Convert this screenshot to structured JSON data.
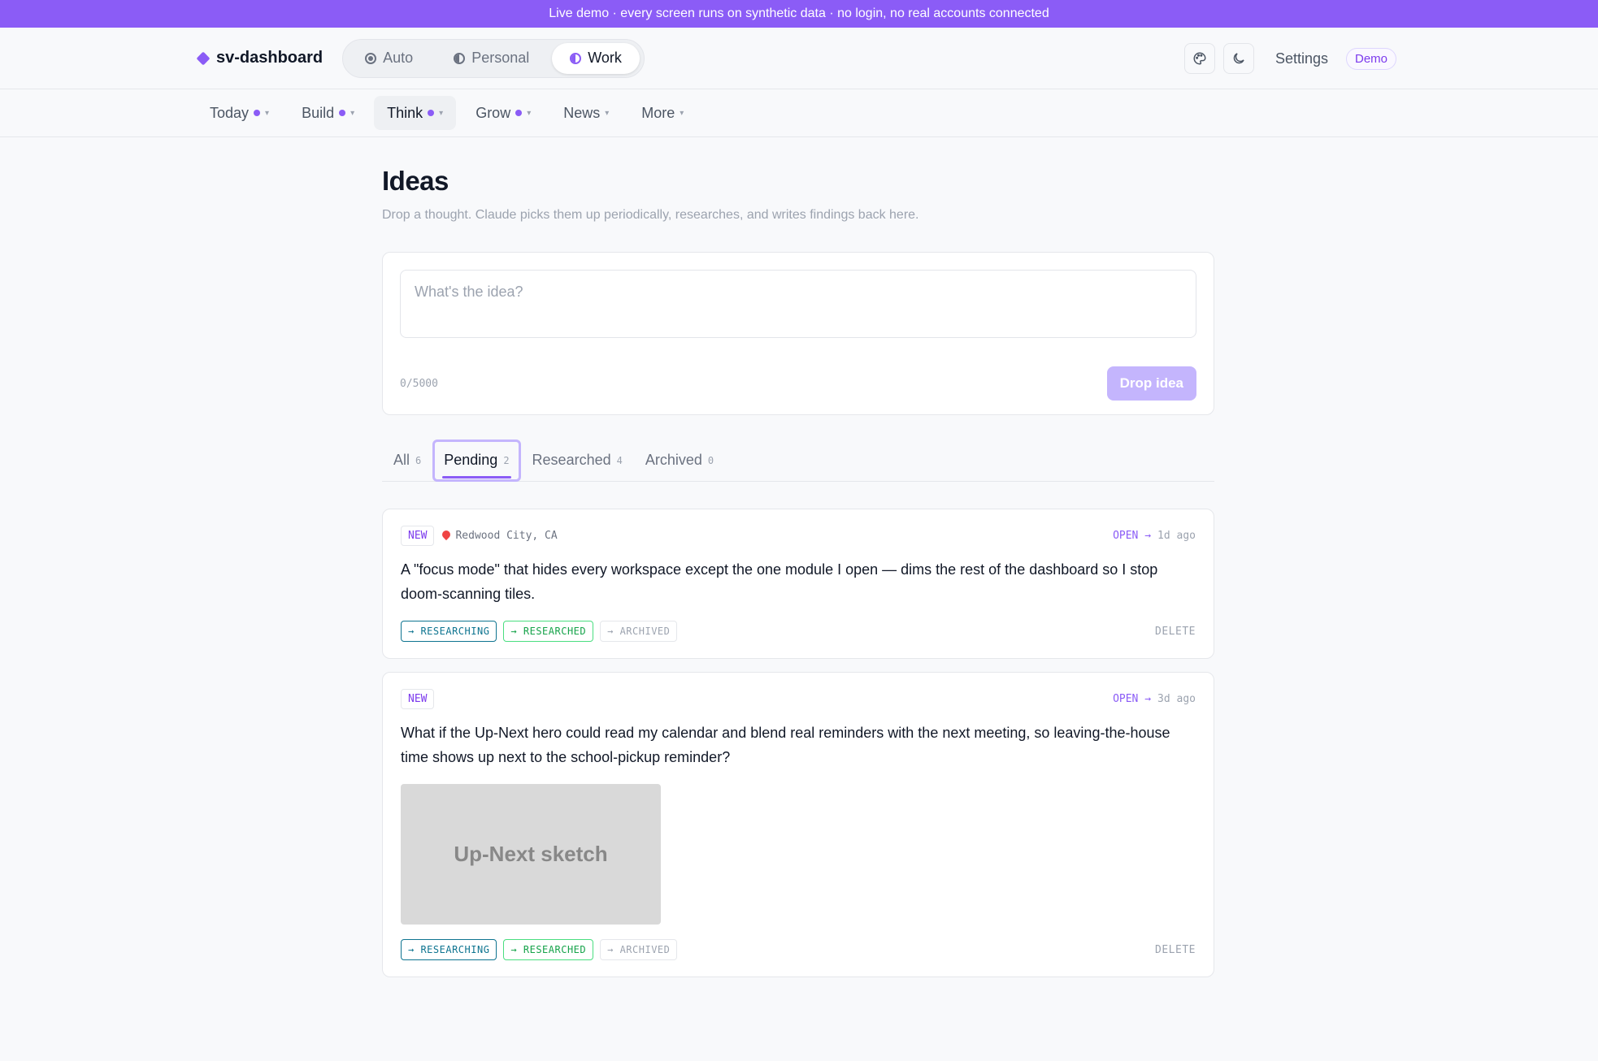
{
  "banner": {
    "text": "Live demo · every screen runs on synthetic data · no login, no real accounts connected"
  },
  "header": {
    "brand": "sv-dashboard",
    "modes": [
      {
        "label": "Auto",
        "icon": "auto-mode-icon",
        "active": false
      },
      {
        "label": "Personal",
        "icon": "personal-mode-icon",
        "active": false
      },
      {
        "label": "Work",
        "icon": "work-mode-icon",
        "active": true
      }
    ],
    "settings_label": "Settings",
    "demo_badge": "Demo"
  },
  "nav": {
    "items": [
      {
        "label": "Today",
        "dot": true
      },
      {
        "label": "Build",
        "dot": true
      },
      {
        "label": "Think",
        "dot": true,
        "active": true
      },
      {
        "label": "Grow",
        "dot": true
      },
      {
        "label": "News",
        "dot": false
      },
      {
        "label": "More",
        "dot": false
      }
    ]
  },
  "page": {
    "title": "Ideas",
    "subtitle": "Drop a thought. Claude picks them up periodically, researches, and writes findings back here."
  },
  "compose": {
    "placeholder": "What's the idea?",
    "counter": "0/5000",
    "button_label": "Drop idea"
  },
  "tabs": [
    {
      "label": "All",
      "count": "6"
    },
    {
      "label": "Pending",
      "count": "2",
      "active": true
    },
    {
      "label": "Researched",
      "count": "4"
    },
    {
      "label": "Archived",
      "count": "0"
    }
  ],
  "ideas": [
    {
      "badge": "NEW",
      "location": "Redwood City, CA",
      "open_label": "OPEN →",
      "time": "1d ago",
      "text": "A \"focus mode\" that hides every workspace except the one module I open — dims the rest of the dashboard so I stop doom-scanning tiles.",
      "actions": [
        "→ RESEARCHING",
        "→ RESEARCHED",
        "→ ARCHIVED"
      ],
      "delete_label": "DELETE"
    },
    {
      "badge": "NEW",
      "open_label": "OPEN →",
      "time": "3d ago",
      "text": "What if the Up-Next hero could read my calendar and blend real reminders with the next meeting, so leaving-the-house time shows up next to the school-pickup reminder?",
      "image_label": "Up-Next sketch",
      "actions": [
        "→ RESEARCHING",
        "→ RESEARCHED",
        "→ ARCHIVED"
      ],
      "delete_label": "DELETE"
    }
  ],
  "colors": {
    "accent": "#8b5cf6",
    "banner": "#8b5cf6",
    "researching": "#0e7490",
    "researched": "#16a34a"
  }
}
